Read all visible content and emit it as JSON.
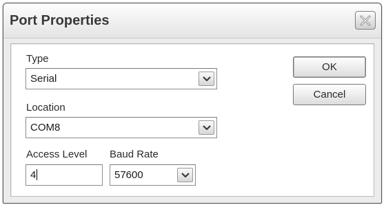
{
  "dialog": {
    "title": "Port Properties",
    "close_icon": "close-icon"
  },
  "type": {
    "label": "Type",
    "value": "Serial"
  },
  "location": {
    "label": "Location",
    "value": "COM8"
  },
  "access_level": {
    "label": "Access Level",
    "value": "4"
  },
  "baud_rate": {
    "label": "Baud Rate",
    "value": "57600"
  },
  "buttons": {
    "ok_label": "OK",
    "cancel_label": "Cancel"
  },
  "icons": {
    "dropdown": "chevron-down-icon"
  }
}
